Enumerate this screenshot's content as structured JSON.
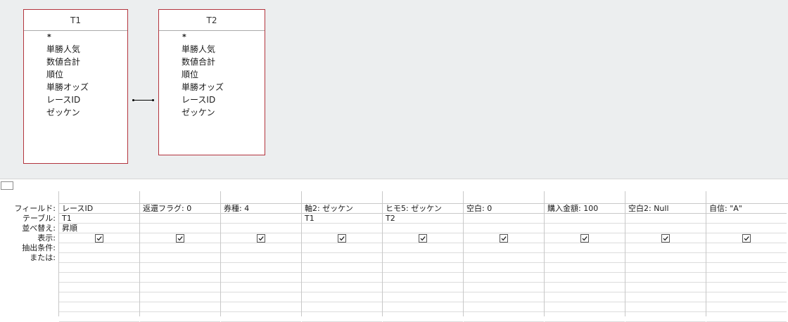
{
  "tables": [
    {
      "title": "T1",
      "fields": [
        "*",
        "単勝人気",
        "数値合計",
        "順位",
        "単勝オッズ",
        "レースID",
        "ゼッケン"
      ]
    },
    {
      "title": "T2",
      "fields": [
        "*",
        "単勝人気",
        "数値合計",
        "順位",
        "単勝オッズ",
        "レースID",
        "ゼッケン"
      ]
    }
  ],
  "grid": {
    "row_labels": {
      "field": "フィールド:",
      "table": "テーブル:",
      "sort": "並べ替え:",
      "show": "表示:",
      "criteria": "抽出条件:",
      "or": "または:"
    },
    "columns": [
      {
        "field": "レースID",
        "table": "T1",
        "sort": "昇順",
        "show": true
      },
      {
        "field": "返還フラグ: 0",
        "table": "",
        "sort": "",
        "show": true
      },
      {
        "field": "券種: 4",
        "table": "",
        "sort": "",
        "show": true,
        "table_dropdown": true
      },
      {
        "field": "軸2: ゼッケン",
        "table": "T1",
        "sort": "",
        "show": true
      },
      {
        "field": "ヒモ5: ゼッケン",
        "table": "T2",
        "sort": "",
        "show": true
      },
      {
        "field": "空白: 0",
        "table": "",
        "sort": "",
        "show": true
      },
      {
        "field": "購入金額: 100",
        "table": "",
        "sort": "",
        "show": true
      },
      {
        "field": "空白2: Null",
        "table": "",
        "sort": "",
        "show": true
      },
      {
        "field": "自信: \"A\"",
        "table": "",
        "sort": "",
        "show": true
      }
    ]
  },
  "colors": {
    "table_border": "#b3343d",
    "pane_bg": "#eceeef",
    "grid_line": "#c8c8c8"
  },
  "icons": {
    "checkbox": "checked-checkbox-icon",
    "dropdown": "chevron-down-icon"
  }
}
